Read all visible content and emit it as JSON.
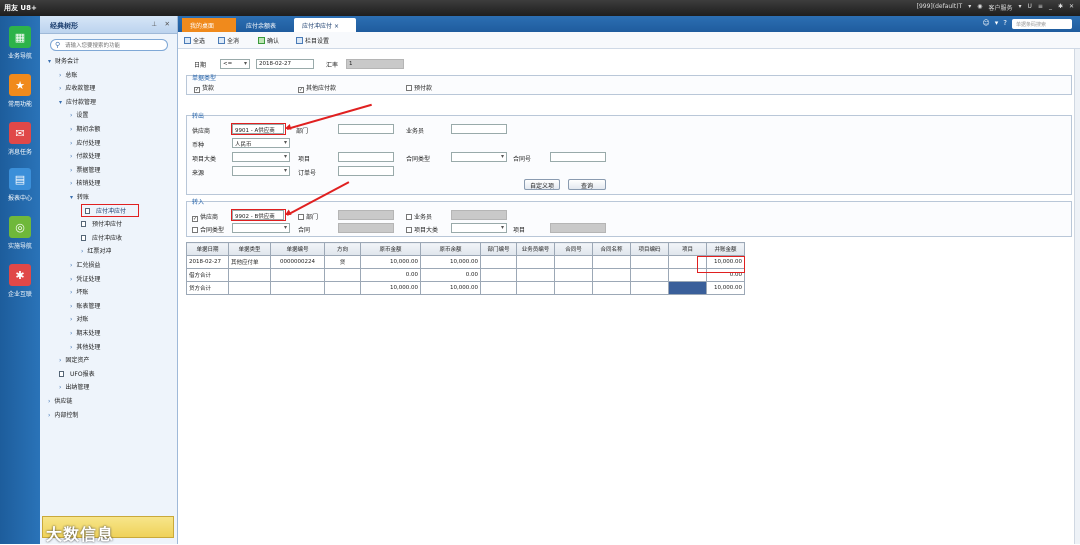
{
  "app": {
    "logo": "用友 U8+",
    "status": "[999](default)T",
    "service": "客户服务",
    "search_placeholder": "单据条码搜索"
  },
  "leftbar": [
    {
      "label": "业务导航",
      "icon": "grid-icon",
      "color": "#2db34a",
      "glyph": "▦"
    },
    {
      "label": "常用功能",
      "icon": "star-icon",
      "color": "#f08a1c",
      "glyph": "★"
    },
    {
      "label": "消息任务",
      "icon": "mail-icon",
      "color": "#e04848",
      "glyph": "✉"
    },
    {
      "label": "报表中心",
      "icon": "report-icon",
      "color": "#3b8fd9",
      "glyph": "▤"
    },
    {
      "label": "实施导航",
      "icon": "compass-icon",
      "color": "#6fb83a",
      "glyph": "◎"
    },
    {
      "label": "企业互联",
      "icon": "connect-icon",
      "color": "#e04848",
      "glyph": "✱"
    }
  ],
  "nav": {
    "title": "经典树形",
    "search_placeholder": "请输入您要搜索的功能",
    "items": [
      {
        "label": "财务会计",
        "lvl": 1,
        "type": "open"
      },
      {
        "label": "总账",
        "lvl": 2,
        "type": "closed"
      },
      {
        "label": "应收款管理",
        "lvl": 2,
        "type": "closed"
      },
      {
        "label": "应付款管理",
        "lvl": 2,
        "type": "open"
      },
      {
        "label": "设置",
        "lvl": 3,
        "type": "closed"
      },
      {
        "label": "期初余额",
        "lvl": 3,
        "type": "closed"
      },
      {
        "label": "应付处理",
        "lvl": 3,
        "type": "closed"
      },
      {
        "label": "付款处理",
        "lvl": 3,
        "type": "closed"
      },
      {
        "label": "票据管理",
        "lvl": 3,
        "type": "closed"
      },
      {
        "label": "核销处理",
        "lvl": 3,
        "type": "closed"
      },
      {
        "label": "转账",
        "lvl": 3,
        "type": "open"
      },
      {
        "label": "应付冲应付",
        "lvl": 4,
        "type": "doc",
        "highlight": true
      },
      {
        "label": "预付冲应付",
        "lvl": 4,
        "type": "doc"
      },
      {
        "label": "应付冲应收",
        "lvl": 4,
        "type": "doc"
      },
      {
        "label": "红票对冲",
        "lvl": 4,
        "type": "closed"
      },
      {
        "label": "汇兑损益",
        "lvl": 3,
        "type": "closed"
      },
      {
        "label": "凭证处理",
        "lvl": 3,
        "type": "closed"
      },
      {
        "label": "坏账",
        "lvl": 3,
        "type": "closed"
      },
      {
        "label": "账表管理",
        "lvl": 3,
        "type": "closed"
      },
      {
        "label": "对账",
        "lvl": 3,
        "type": "closed"
      },
      {
        "label": "期末处理",
        "lvl": 3,
        "type": "closed"
      },
      {
        "label": "其他处理",
        "lvl": 3,
        "type": "closed"
      },
      {
        "label": "固定资产",
        "lvl": 2,
        "type": "closed"
      },
      {
        "label": "UFO报表",
        "lvl": 2,
        "type": "doc"
      },
      {
        "label": "出纳管理",
        "lvl": 2,
        "type": "closed"
      },
      {
        "label": "供应链",
        "lvl": 1,
        "type": "closed"
      },
      {
        "label": "内部控制",
        "lvl": 1,
        "type": "closed"
      }
    ],
    "watermark": "大数信息"
  },
  "tabs": [
    {
      "label": "我的桌面",
      "kind": "home"
    },
    {
      "label": "应付余额表",
      "kind": "normal"
    },
    {
      "label": "应付冲应付",
      "kind": "active"
    }
  ],
  "toolbar": {
    "select_all": "全选",
    "clear_all": "全消",
    "confirm": "确认",
    "columns": "栏目设置"
  },
  "form": {
    "date_label": "日期",
    "date_op": "<=",
    "date_value": "2018-02-27",
    "rate_label": "汇率",
    "rate_value": "1",
    "doctype_section": "单据类型",
    "doctype": [
      {
        "label": "货款",
        "checked": true
      },
      {
        "label": "其他应付款",
        "checked": true
      },
      {
        "label": "预付款",
        "checked": false
      }
    ],
    "out_section": "转出",
    "supplier_label": "供应商",
    "supplier_value": "9901 - A供应商",
    "dept_label": "部门",
    "clerk_label": "业务员",
    "currency_label": "币种",
    "currency_value": "人民币",
    "itemclass_label": "项目大类",
    "item_label": "项目",
    "contracttype_label": "合同类型",
    "contractno_label": "合同号",
    "source_label": "来源",
    "order_label": "订单号",
    "custom_btn": "自定义项",
    "query_btn": "查询",
    "in_section": "转入",
    "in_supplier_label": "供应商",
    "in_supplier_value": "9902 - B供应商",
    "in_dept_label": "部门",
    "in_clerk_label": "业务员",
    "in_contracttype_label": "合同类型",
    "in_contract_label": "合同",
    "in_itemclass_label": "项目大类",
    "in_item_label": "项目"
  },
  "grid": {
    "headers": [
      "单据日期",
      "单据类型",
      "单据编号",
      "方向",
      "原币金额",
      "原币余额",
      "部门编号",
      "业务员编号",
      "合同号",
      "合同名称",
      "项目编码",
      "项目",
      "并账金额"
    ],
    "rows": [
      [
        "2018-02-27",
        "其他应付单",
        "0000000224",
        "贷",
        "10,000.00",
        "10,000.00",
        "",
        "",
        "",
        "",
        "",
        "",
        "10,000.00"
      ],
      [
        "借方合计",
        "",
        "",
        "",
        "0.00",
        "0.00",
        "",
        "",
        "",
        "",
        "",
        "",
        "0.00"
      ],
      [
        "贷方合计",
        "",
        "",
        "",
        "10,000.00",
        "10,000.00",
        "",
        "",
        "",
        "",
        "",
        "",
        "10,000.00"
      ]
    ]
  }
}
